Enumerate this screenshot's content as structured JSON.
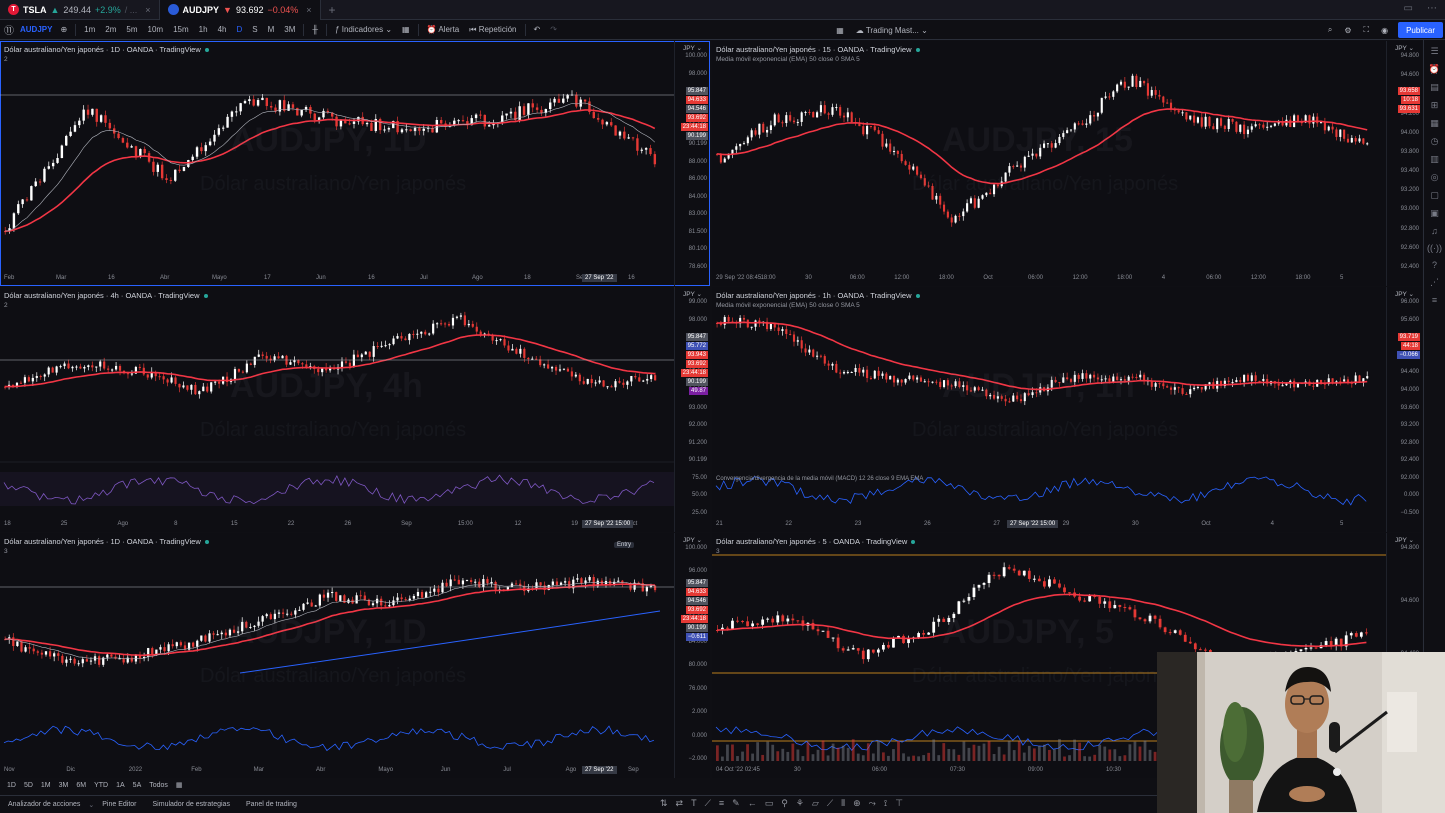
{
  "tabs": [
    {
      "symbol": "TSLA",
      "price": "249.44",
      "change": "+2.9%",
      "suffix": "/ ...",
      "dir": "up",
      "logo": "T",
      "logo_color": "#e31937"
    },
    {
      "symbol": "AUDJPY",
      "price": "93.692",
      "change": "−0.04%",
      "dir": "down",
      "logo": "",
      "logo_color": "#2a5bd7"
    }
  ],
  "toolbar": {
    "symbol": "AUDJPY",
    "intervals": [
      "1m",
      "2m",
      "5m",
      "10m",
      "15m",
      "1h",
      "4h",
      "D",
      "S",
      "M",
      "3M"
    ],
    "selected_interval": "D",
    "indicators_label": "Indicadores",
    "alert_label": "Alerta",
    "replay_label": "Repetición",
    "layout_name": "Trading Mast...",
    "publish_label": "Publicar"
  },
  "colors": {
    "accent": "#2962ff",
    "up": "#26a69a",
    "down": "#ef5350",
    "ema": "#f23645",
    "macd": "#2962ff"
  },
  "panes": [
    {
      "id": "p1",
      "title": "Dólar australiano/Yen japonés · 1D · OANDA · TradingView",
      "sub": "2",
      "watermark": "AUDJPY, 1D",
      "watermark2": "Dólar australiano/Yen japonés",
      "currency": "JPY",
      "prices": [
        "100.000",
        "98.000",
        "96.000",
        "94.000",
        "92.000",
        "90.199",
        "88.000",
        "86.000",
        "84.000",
        "83.000",
        "81.500",
        "80.100",
        "78.600"
      ],
      "tags": [
        {
          "t": "95.847",
          "c": "grey"
        },
        {
          "t": "94.633",
          "c": "red"
        },
        {
          "t": "94.546",
          "c": "grey"
        },
        {
          "t": "93.692",
          "c": "red"
        },
        {
          "t": "23:44:18",
          "c": "red"
        },
        {
          "t": "90.199",
          "c": "grey"
        }
      ],
      "times": [
        "Feb",
        "Mar",
        "16",
        "Abr",
        "Mayo",
        "17",
        "Jun",
        "16",
        "Jul",
        "Ago",
        "18",
        "Sep",
        "16"
      ],
      "cross_time": "27 Sep '22",
      "ema_label": ""
    },
    {
      "id": "p2",
      "title": "Dólar australiano/Yen japonés · 15 · OANDA · TradingView",
      "sub": "Media móvil exponencial (EMA) 50 close 0 SMA 5",
      "watermark": "AUDJPY, 15",
      "watermark2": "Dólar australiano/Yen japonés",
      "currency": "JPY",
      "prices": [
        "94.800",
        "94.600",
        "94.400",
        "94.200",
        "94.000",
        "93.800",
        "93.400",
        "93.200",
        "93.000",
        "92.800",
        "92.600",
        "92.400"
      ],
      "tags": [
        {
          "t": "93.658",
          "c": "red"
        },
        {
          "t": "10:18",
          "c": "red"
        },
        {
          "t": "93.631",
          "c": "red"
        }
      ],
      "times": [
        "29 Sep '22  08:45",
        "18:00",
        "30",
        "06:00",
        "12:00",
        "18:00",
        "Oct",
        "06:00",
        "12:00",
        "18:00",
        "4",
        "06:00",
        "12:00",
        "18:00",
        "5"
      ],
      "cross_time": "",
      "ema_label": ""
    },
    {
      "id": "p3",
      "title": "Dólar australiano/Yen japonés · 4h · OANDA · TradingView",
      "sub": "2",
      "watermark": "AUDJPY, 4h",
      "watermark2": "Dólar australiano/Yen japonés",
      "currency": "JPY",
      "prices": [
        "99.000",
        "98.000",
        "97.000",
        "96.000",
        "95.000",
        "94.000",
        "93.000",
        "92.000",
        "91.200",
        "90.199",
        "75.00",
        "50.00",
        "25.00"
      ],
      "tags": [
        {
          "t": "95.847",
          "c": "grey"
        },
        {
          "t": "95.772",
          "c": "blue"
        },
        {
          "t": "93.943",
          "c": "red"
        },
        {
          "t": "93.692",
          "c": "red"
        },
        {
          "t": "23:44:18",
          "c": "red"
        },
        {
          "t": "90.199",
          "c": "grey"
        },
        {
          "t": "49.87",
          "c": "purple"
        }
      ],
      "times": [
        "18",
        "25",
        "Ago",
        "8",
        "15",
        "22",
        "26",
        "Sep",
        "15:00",
        "12",
        "19",
        "Oct"
      ],
      "cross_time": "27 Sep '22   15:00",
      "ema_label": ""
    },
    {
      "id": "p4",
      "title": "Dólar australiano/Yen japonés · 1h · OANDA · TradingView",
      "sub": "Media móvil exponencial (EMA) 50 close 0 SMA 5",
      "watermark": "AUDJPY, 1h",
      "watermark2": "Dólar australiano/Yen japonés",
      "currency": "JPY",
      "prices": [
        "96.000",
        "95.600",
        "95.200",
        "94.800",
        "94.400",
        "94.000",
        "93.600",
        "93.200",
        "92.800",
        "92.400",
        "92.000",
        "0.000",
        "−0.500"
      ],
      "tags": [
        {
          "t": "93.719",
          "c": "red"
        },
        {
          "t": "44:18",
          "c": "red"
        },
        {
          "t": "−0.066",
          "c": "blue"
        }
      ],
      "times": [
        "21",
        "22",
        "23",
        "26",
        "27",
        "29",
        "30",
        "Oct",
        "4",
        "5"
      ],
      "cross_time": "27 Sep '22   15:00",
      "ema_label": "Convergencia/divergencia de la media móvil (MACD) 12 26 close 9 EMA EMA"
    },
    {
      "id": "p5",
      "title": "Dólar australiano/Yen japonés · 1D · OANDA · TradingView",
      "sub": "3",
      "watermark": "AUDJPY, 1D",
      "watermark2": "Dólar australiano/Yen japonés",
      "currency": "JPY",
      "prices": [
        "100.000",
        "96.000",
        "92.000",
        "88.000",
        "84.000",
        "80.000",
        "76.000",
        "2.000",
        "0.000",
        "−2.000"
      ],
      "tags": [
        {
          "t": "95.847",
          "c": "grey"
        },
        {
          "t": "94.633",
          "c": "red"
        },
        {
          "t": "94.546",
          "c": "grey"
        },
        {
          "t": "93.692",
          "c": "red"
        },
        {
          "t": "23:44:18",
          "c": "red"
        },
        {
          "t": "90.199",
          "c": "grey"
        },
        {
          "t": "−0.611",
          "c": "blue"
        }
      ],
      "times": [
        "Nov",
        "Dic",
        "2022",
        "Feb",
        "Mar",
        "Abr",
        "Mayo",
        "Jun",
        "Jul",
        "Ago",
        "Sep"
      ],
      "cross_time": "27 Sep '22",
      "entry": "Entry",
      "ema_label": ""
    },
    {
      "id": "p6",
      "title": "Dólar australiano/Yen japonés · 5 · OANDA · TradingView",
      "sub": "3",
      "watermark": "AUDJPY, 5",
      "watermark2": "Dólar australiano/Yen japonés",
      "currency": "JPY",
      "prices": [
        "94.800",
        "94.600",
        "94.400",
        "94.200",
        "94.000"
      ],
      "tags": [],
      "times": [
        "04 Oct '22  02:45",
        "30",
        "06:00",
        "07:30",
        "09:00",
        "10:30",
        "12:00",
        "13:30",
        "15:00"
      ],
      "cross_time": "",
      "ema_label": ""
    }
  ],
  "range_buttons": [
    "1D",
    "5D",
    "1M",
    "3M",
    "6M",
    "YTD",
    "1A",
    "5A",
    "Todos"
  ],
  "bottom_tabs": [
    "Analizador de acciones",
    "Pine Editor",
    "Simulador de estrategias",
    "Panel de trading"
  ]
}
